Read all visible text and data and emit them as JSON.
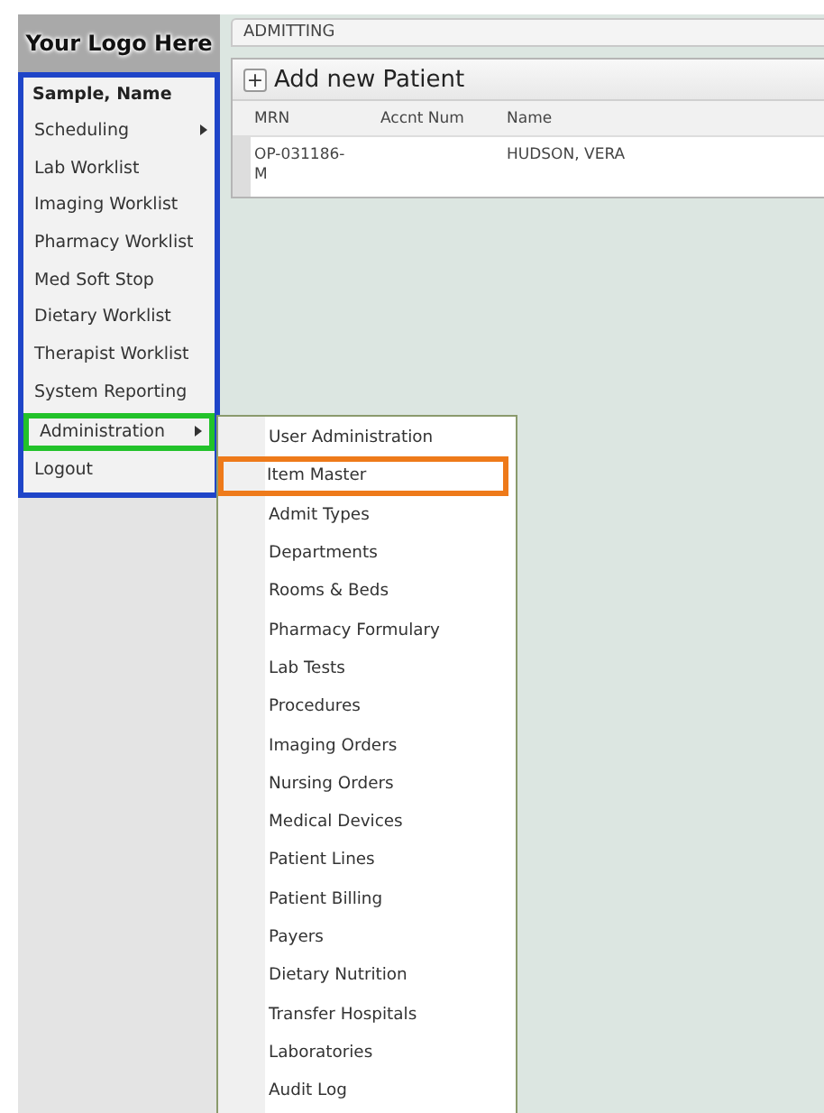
{
  "logo": {
    "text": "Your Logo Here"
  },
  "sidebar": {
    "color": "#1f45c8",
    "user": "Sample, Name",
    "items": [
      {
        "label": "Scheduling",
        "has_submenu": true
      },
      {
        "label": "Lab Worklist",
        "has_submenu": false
      },
      {
        "label": "Imaging Worklist",
        "has_submenu": false
      },
      {
        "label": "Pharmacy Worklist",
        "has_submenu": false
      },
      {
        "label": "Med Soft Stop",
        "has_submenu": false
      },
      {
        "label": "Dietary Worklist",
        "has_submenu": false
      },
      {
        "label": "Therapist Worklist",
        "has_submenu": false
      },
      {
        "label": "System Reporting",
        "has_submenu": false
      },
      {
        "label": "Administration",
        "has_submenu": true,
        "color": "#22c22a"
      },
      {
        "label": "Logout",
        "has_submenu": false
      }
    ]
  },
  "tab": {
    "label": "ADMITTING"
  },
  "panel": {
    "add_button": "+",
    "title": "Add new Patient",
    "columns": [
      "MRN",
      "Accnt Num",
      "Name"
    ],
    "rows": [
      {
        "mrn": "OP-031186-M",
        "name": "HUDSON, VERA"
      }
    ]
  },
  "submenu": {
    "items": [
      {
        "label": "User Administration"
      },
      {
        "label": "Item Master",
        "color": "#ee7a1a"
      },
      {
        "label": "Admit Types"
      },
      {
        "label": "Departments"
      },
      {
        "label": "Rooms & Beds"
      },
      {
        "label": "Pharmacy Formulary"
      },
      {
        "label": "Lab Tests"
      },
      {
        "label": "Procedures"
      },
      {
        "label": "Imaging Orders"
      },
      {
        "label": "Nursing Orders"
      },
      {
        "label": "Medical Devices"
      },
      {
        "label": "Patient Lines"
      },
      {
        "label": "Patient Billing"
      },
      {
        "label": "Payers"
      },
      {
        "label": "Dietary Nutrition"
      },
      {
        "label": "Transfer Hospitals"
      },
      {
        "label": "Laboratories"
      },
      {
        "label": "Audit Log"
      }
    ]
  }
}
